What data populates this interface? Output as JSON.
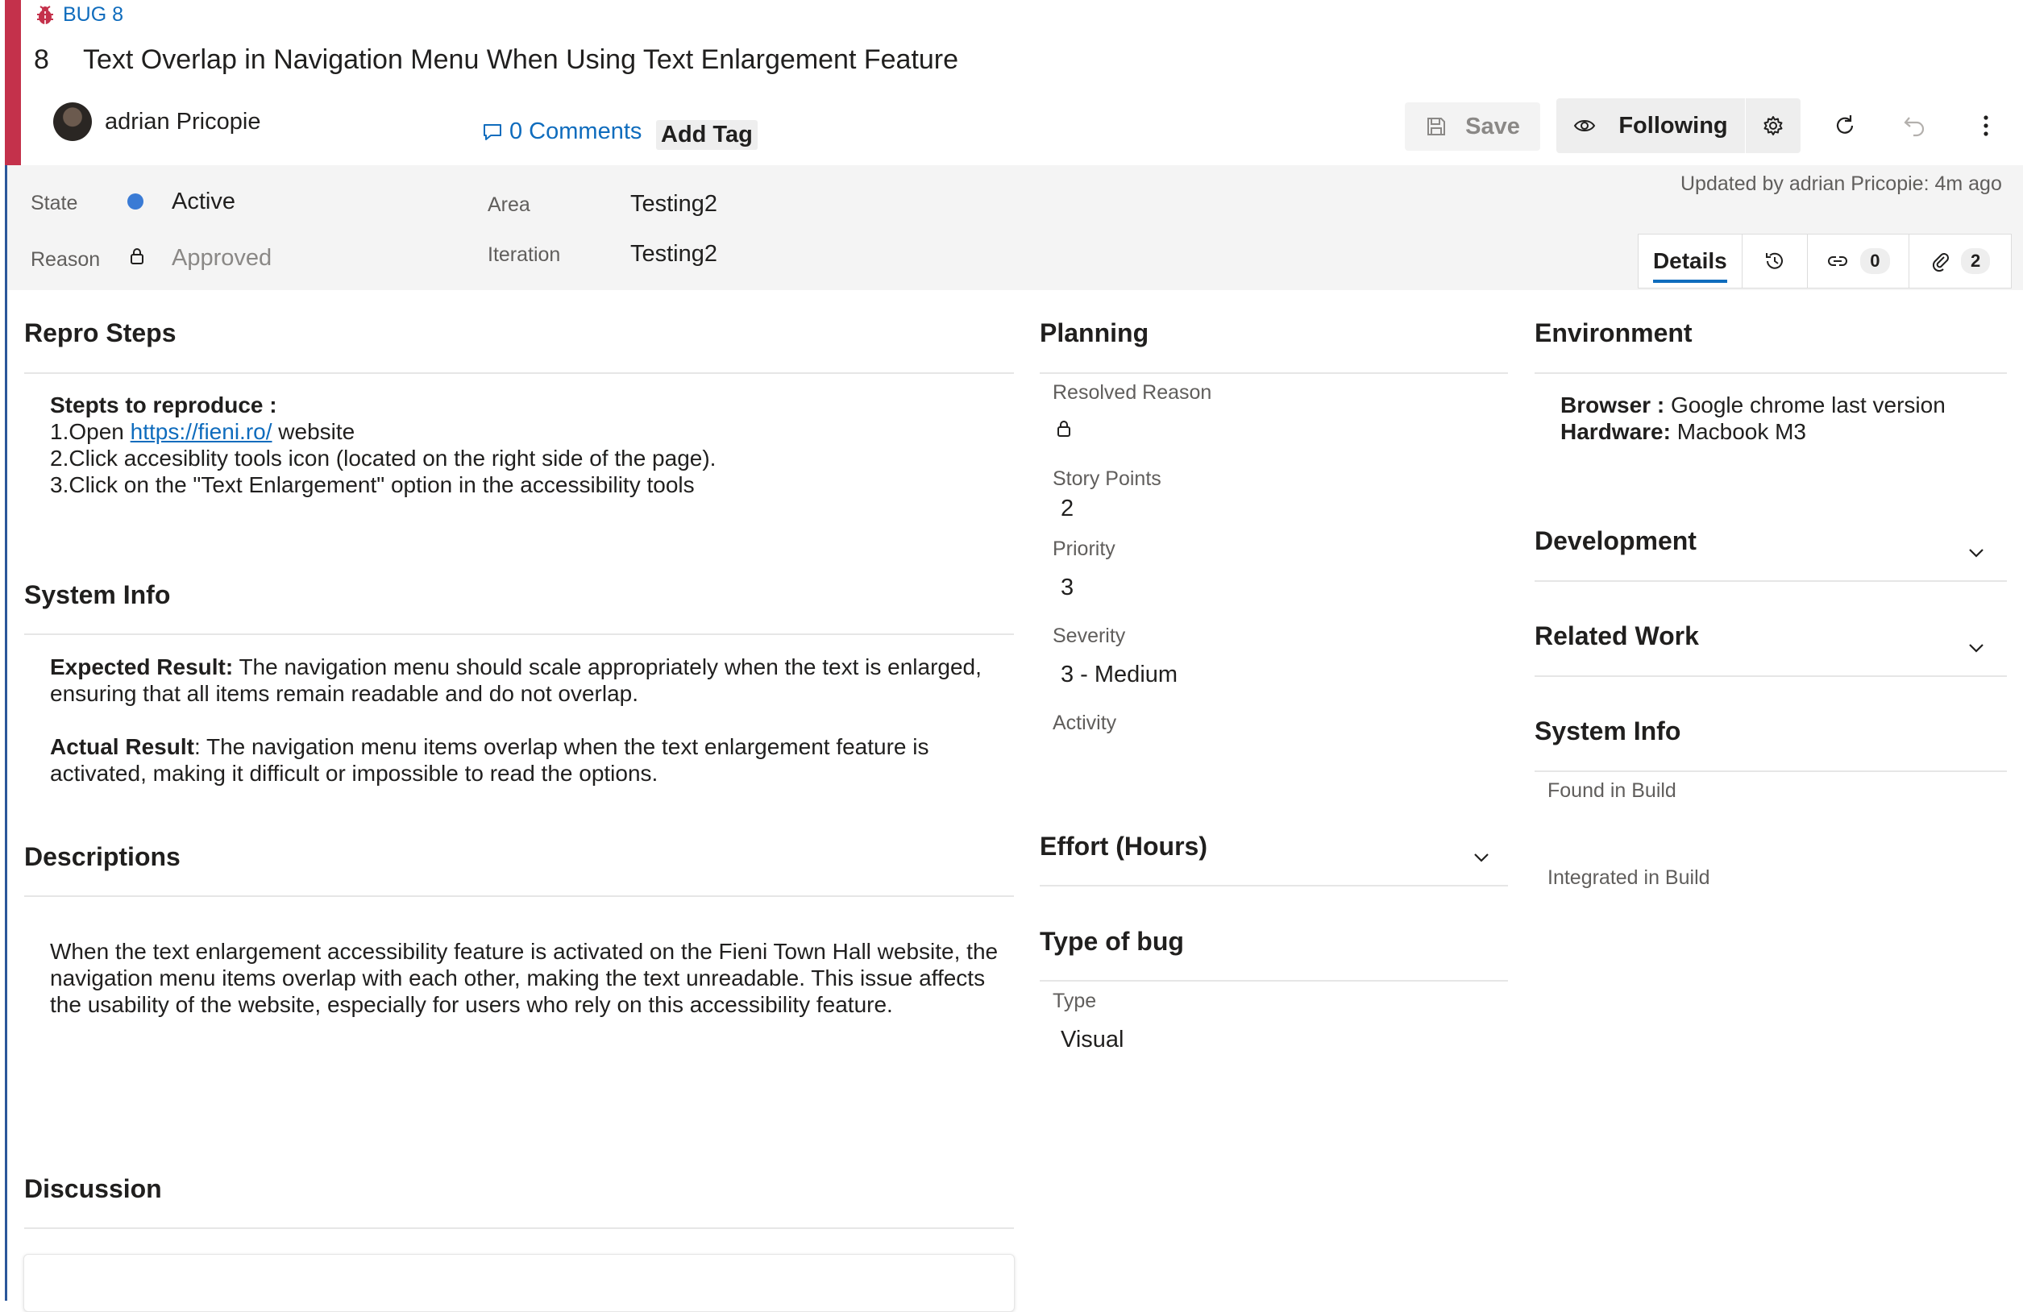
{
  "header": {
    "type_label": "BUG 8",
    "work_item_id": "8",
    "title": "Text Overlap in Navigation Menu When Using Text Enlargement Feature",
    "author": "adrian Pricopie",
    "comments_label": "0 Comments",
    "add_tag_label": "Add Tag",
    "type_color": "#c4314b"
  },
  "toolbar": {
    "save_label": "Save",
    "following_label": "Following"
  },
  "fields": {
    "state_label": "State",
    "state_value": "Active",
    "reason_label": "Reason",
    "reason_value": "Approved",
    "area_label": "Area",
    "area_value": "Testing2",
    "iteration_label": "Iteration",
    "iteration_value": "Testing2",
    "updated_text": "Updated by adrian Pricopie: 4m ago",
    "state_color": "#3a7bd5"
  },
  "tabs": {
    "details_label": "Details",
    "links_count": "0",
    "attachments_count": "2"
  },
  "repro": {
    "heading": "Repro Steps",
    "intro": "Stepts to reproduce :",
    "step1_prefix": "1.Open",
    "step1_link": "https://fieni.ro/",
    "step1_suffix": "website",
    "step2": "2.Click accesiblity tools icon (located on the right side of the page).",
    "step3": "3.Click on the \"Text Enlargement\" option in the accessibility tools"
  },
  "system_info_left": {
    "heading": "System Info",
    "expected_label": "Expected Result:",
    "expected_text": "The navigation menu should scale appropriately when the text is enlarged, ensuring that all items remain readable and do not overlap.",
    "actual_label": "Actual Result",
    "actual_text": ": The navigation menu items overlap when the text enlargement feature is activated, making it difficult or impossible to read the options."
  },
  "descriptions": {
    "heading": "Descriptions",
    "text": "When the text enlargement accessibility feature is activated on the Fieni Town Hall website, the navigation menu items overlap with each other, making the text unreadable. This issue affects the usability of the website, especially for users who rely on this accessibility feature."
  },
  "discussion": {
    "heading": "Discussion"
  },
  "planning": {
    "heading": "Planning",
    "resolved_reason_label": "Resolved Reason",
    "story_points_label": "Story Points",
    "story_points_value": "2",
    "priority_label": "Priority",
    "priority_value": "3",
    "severity_label": "Severity",
    "severity_value": "3 - Medium",
    "activity_label": "Activity"
  },
  "effort": {
    "heading": "Effort (Hours)"
  },
  "type_of_bug": {
    "heading": "Type of bug",
    "type_label": "Type",
    "type_value": "Visual"
  },
  "environment": {
    "heading": "Environment",
    "browser_label": "Browser :",
    "browser_value": "Google chrome last version",
    "hardware_label": "Hardware:",
    "hardware_value": "Macbook M3"
  },
  "development": {
    "heading": "Development"
  },
  "related_work": {
    "heading": "Related Work"
  },
  "system_info_right": {
    "heading": "System Info",
    "found_in_build_label": "Found in Build",
    "integrated_in_build_label": "Integrated in Build"
  }
}
